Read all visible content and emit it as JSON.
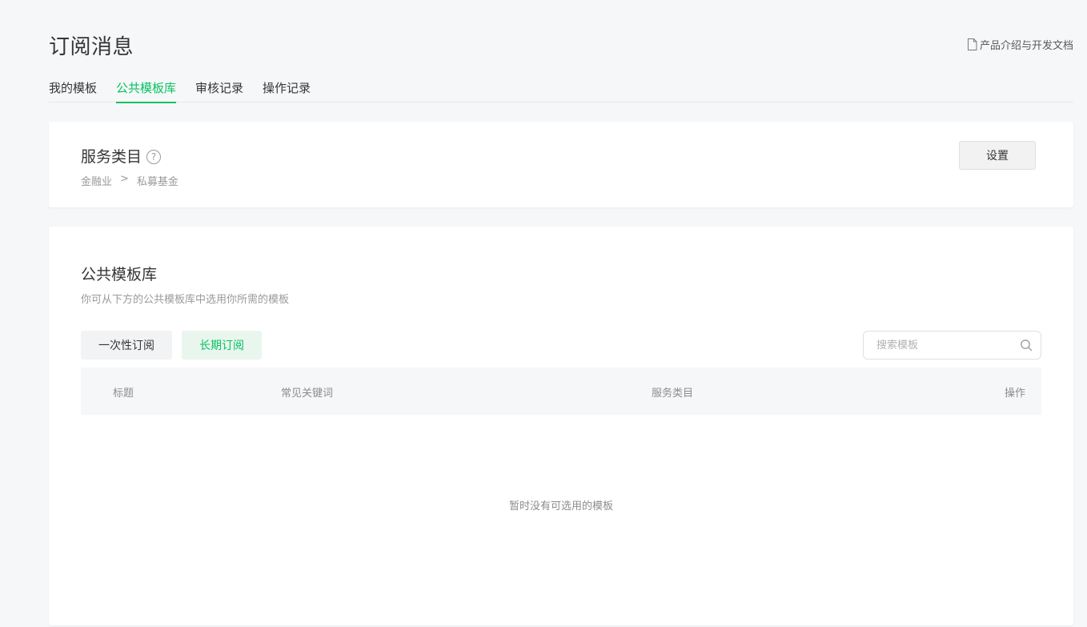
{
  "header": {
    "title": "订阅消息",
    "doc_link": "产品介绍与开发文档",
    "doc_icon": "document-icon"
  },
  "tabs": [
    {
      "label": "我的模板",
      "active": false
    },
    {
      "label": "公共模板库",
      "active": true
    },
    {
      "label": "审核记录",
      "active": false
    },
    {
      "label": "操作记录",
      "active": false
    }
  ],
  "service": {
    "title": "服务类目",
    "help_icon": "?",
    "path": [
      "金融业",
      ">",
      "私募基金"
    ],
    "settings_label": "设置"
  },
  "library": {
    "title": "公共模板库",
    "description": "你可从下方的公共模板库中选用你所需的模板",
    "filters": [
      {
        "label": "一次性订阅",
        "active": false
      },
      {
        "label": "长期订阅",
        "active": true
      }
    ],
    "search_placeholder": "搜索模板",
    "columns": [
      "标题",
      "常见关键词",
      "服务类目",
      "操作"
    ],
    "empty_text": "暂时没有可选用的模板"
  },
  "colors": {
    "accent": "#07c160",
    "accent_bg": "#e9f6ee",
    "text": "#353535",
    "muted": "#9a9a9a"
  }
}
